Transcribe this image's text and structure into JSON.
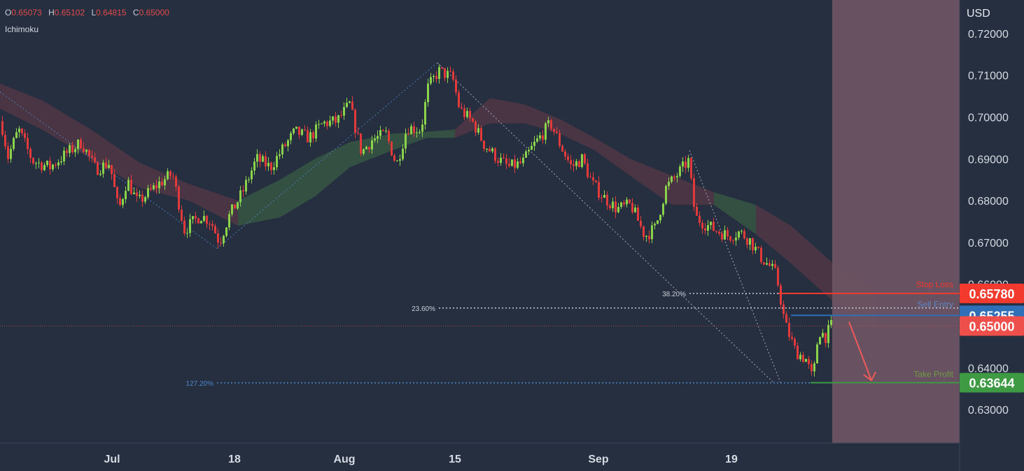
{
  "legend": {
    "open_label": "O",
    "open": "0.65073",
    "high_label": "H",
    "high": "0.65102",
    "low_label": "L",
    "low": "0.64815",
    "close_label": "C",
    "close": "0.65000",
    "indicator": "Ichimoku"
  },
  "colors": {
    "background": "#252f40",
    "bull": "#8bd34a",
    "bear": "#e23a3a",
    "forecast_zone": "#6e5563",
    "stop_loss": "#f23a2f",
    "entry": "#2f6fb8",
    "take_profit": "#3f9a44",
    "current": "#ef4f4a"
  },
  "chart_data": {
    "type": "candlestick",
    "symbol_currency": "USD",
    "y_range": [
      0.622,
      0.728
    ],
    "y_ticks": [
      "0.72000",
      "0.71000",
      "0.70000",
      "0.69000",
      "0.68000",
      "0.67000",
      "0.66000",
      "0.64000",
      "0.63000"
    ],
    "x_labels": [
      "Jul",
      "18",
      "Aug",
      "15",
      "Sep",
      "19"
    ],
    "price_path": [
      [
        0,
        0.699
      ],
      [
        10,
        0.6905
      ],
      [
        25,
        0.697
      ],
      [
        45,
        0.6895
      ],
      [
        70,
        0.688
      ],
      [
        95,
        0.6915
      ],
      [
        115,
        0.694
      ],
      [
        135,
        0.6875
      ],
      [
        155,
        0.689
      ],
      [
        168,
        0.6775
      ],
      [
        180,
        0.685
      ],
      [
        195,
        0.6795
      ],
      [
        205,
        0.681
      ],
      [
        225,
        0.684
      ],
      [
        245,
        0.6865
      ],
      [
        262,
        0.673
      ],
      [
        285,
        0.6765
      ],
      [
        300,
        0.675
      ],
      [
        312,
        0.67
      ],
      [
        325,
        0.676
      ],
      [
        345,
        0.682
      ],
      [
        365,
        0.69
      ],
      [
        385,
        0.688
      ],
      [
        405,
        0.693
      ],
      [
        420,
        0.6965
      ],
      [
        440,
        0.695
      ],
      [
        460,
        0.6985
      ],
      [
        480,
        0.699
      ],
      [
        498,
        0.703
      ],
      [
        515,
        0.6915
      ],
      [
        530,
        0.6945
      ],
      [
        550,
        0.696
      ],
      [
        565,
        0.6885
      ],
      [
        580,
        0.6975
      ],
      [
        600,
        0.697
      ],
      [
        610,
        0.707
      ],
      [
        625,
        0.711
      ],
      [
        645,
        0.7095
      ],
      [
        655,
        0.702
      ],
      [
        675,
        0.6985
      ],
      [
        690,
        0.6935
      ],
      [
        710,
        0.69
      ],
      [
        725,
        0.688
      ],
      [
        745,
        0.689
      ],
      [
        760,
        0.693
      ],
      [
        785,
        0.6985
      ],
      [
        800,
        0.693
      ],
      [
        815,
        0.688
      ],
      [
        830,
        0.69
      ],
      [
        845,
        0.684
      ],
      [
        860,
        0.681
      ],
      [
        880,
        0.678
      ],
      [
        900,
        0.679
      ],
      [
        920,
        0.6715
      ],
      [
        935,
        0.6735
      ],
      [
        950,
        0.683
      ],
      [
        965,
        0.686
      ],
      [
        982,
        0.6895
      ],
      [
        992,
        0.676
      ],
      [
        1005,
        0.6745
      ],
      [
        1020,
        0.673
      ],
      [
        1040,
        0.6715
      ],
      [
        1055,
        0.6725
      ],
      [
        1070,
        0.6705
      ],
      [
        1085,
        0.6665
      ],
      [
        1100,
        0.664
      ],
      [
        1108,
        0.662
      ],
      [
        1120,
        0.6505
      ],
      [
        1135,
        0.644
      ],
      [
        1150,
        0.642
      ],
      [
        1160,
        0.637
      ],
      [
        1168,
        0.649
      ],
      [
        1178,
        0.6475
      ],
      [
        1186,
        0.65
      ]
    ],
    "ichimoku_cloud": [
      [
        0,
        0.708,
        0.702
      ],
      [
        60,
        0.704,
        0.697
      ],
      [
        130,
        0.697,
        0.69
      ],
      [
        200,
        0.689,
        0.683
      ],
      [
        270,
        0.684,
        0.68
      ],
      [
        340,
        0.68,
        0.674
      ],
      [
        400,
        0.685,
        0.676
      ],
      [
        450,
        0.69,
        0.681
      ],
      [
        500,
        0.694,
        0.688
      ],
      [
        560,
        0.696,
        0.692
      ],
      [
        610,
        0.6965,
        0.695
      ],
      [
        650,
        0.697,
        0.695
      ],
      [
        700,
        0.7045,
        0.6985
      ],
      [
        750,
        0.703,
        0.6985
      ],
      [
        800,
        0.6995,
        0.696
      ],
      [
        850,
        0.695,
        0.692
      ],
      [
        900,
        0.69,
        0.686
      ],
      [
        960,
        0.686,
        0.679
      ],
      [
        1020,
        0.682,
        0.679
      ],
      [
        1080,
        0.679,
        0.672
      ],
      [
        1130,
        0.674,
        0.665
      ],
      [
        1190,
        0.665,
        0.656
      ],
      [
        1250,
        0.659,
        0.649
      ]
    ],
    "harmonic_lines": [
      [
        [
          0,
          0.706
        ],
        [
          310,
          0.6685
        ],
        [
          625,
          0.713
        ],
        [
          1105,
          0.6365
        ]
      ],
      [
        [
          985,
          0.692
        ],
        [
          1115,
          0.6365
        ]
      ]
    ],
    "fib_levels": [
      {
        "label": "38.20%",
        "value": 0.6578
      },
      {
        "label": "23.60%",
        "value": 0.6543
      },
      {
        "label": "127.20%",
        "value": 0.6364
      }
    ],
    "trade_levels": [
      {
        "name": "Stop Loss",
        "value": 0.6578,
        "tag": "0.65780"
      },
      {
        "name": "Sell Entry",
        "value": 0.65255,
        "tag": "0.65255"
      },
      {
        "name": "Take Profit",
        "value": 0.63644,
        "tag": "0.63644"
      }
    ],
    "current_price": {
      "value": 0.65,
      "tag": "0.65000"
    }
  }
}
